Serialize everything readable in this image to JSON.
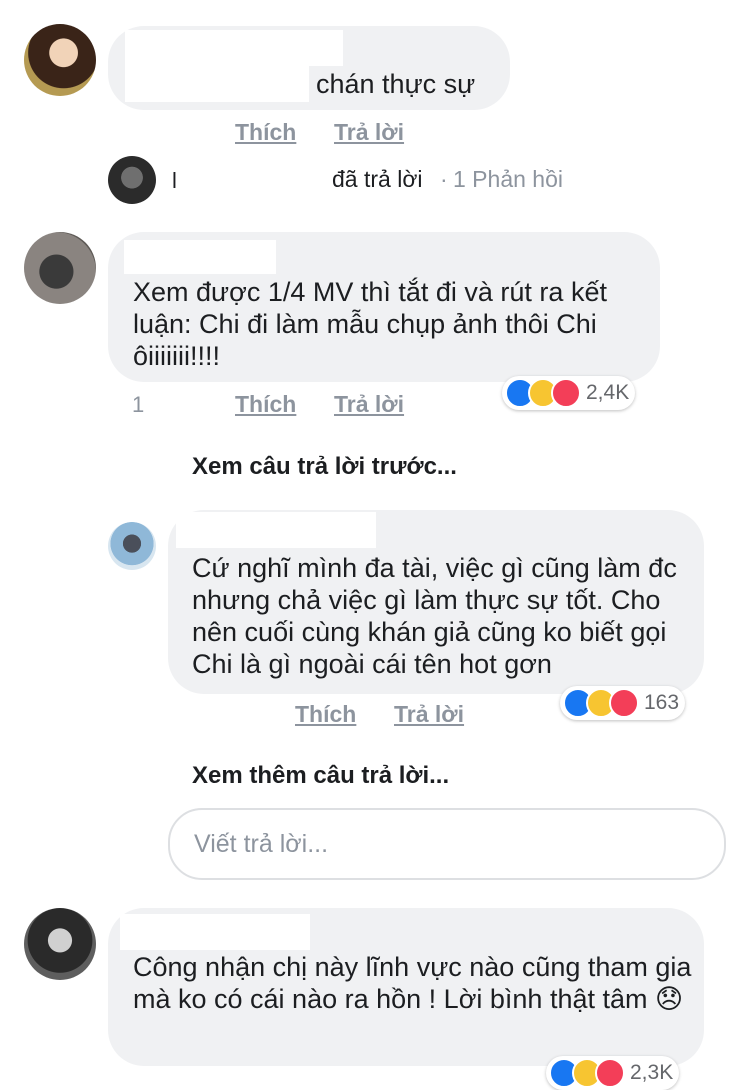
{
  "comments": [
    {
      "text": "chán thực sự",
      "like": "Thích",
      "reply": "Trả lời"
    },
    {
      "text": "Xem được 1/4 MV thì tắt đi và rút ra kết luận: Chi đi làm mẫu chụp ảnh thôi Chi ôiiiiiii!!!!",
      "like": "Thích",
      "reply": "Trả lời",
      "reaction_count": "2,4K"
    },
    {
      "text": "Cứ nghĩ mình đa tài, việc gì cũng làm đc nhưng chả việc gì làm thực sự tốt. Cho nên cuối cùng khán giả cũng ko biết gọi Chi là gì ngoài cái tên hot gơn",
      "like": "Thích",
      "reply": "Trả lời",
      "reaction_count": "163"
    },
    {
      "text": "Công nhận chị này lĩnh vực nào cũng tham gia mà ko có cái nào ra hồn ! Lời bình thật tâm",
      "emoji": "😞",
      "reaction_count": "2,3K"
    }
  ],
  "reply_summary": {
    "initial": "l",
    "replied": "đã trả lời",
    "count": "1 Phản hồi"
  },
  "view_previous": "Xem câu trả lời trước...",
  "view_more": "Xem thêm câu trả lời...",
  "reply_input": {
    "placeholder": "Viết trả lời..."
  },
  "colors": {
    "bubble": "#f0f1f3",
    "like": "#1877f2",
    "haha": "#f7c531",
    "love": "#f33e58",
    "muted": "#8d949e"
  },
  "icons": [
    "like-reaction-icon",
    "haha-reaction-icon",
    "love-reaction-icon",
    "disappointed-emoji"
  ]
}
